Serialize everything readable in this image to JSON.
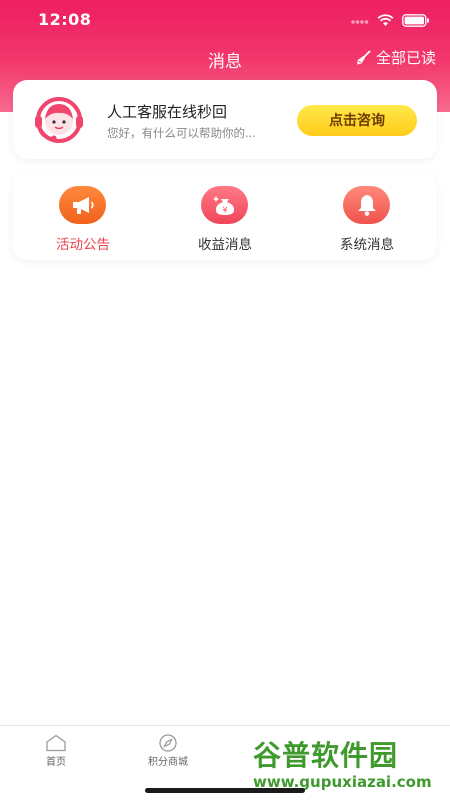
{
  "status": {
    "time": "12:08"
  },
  "header": {
    "title": "消息",
    "mark_all": "全部已读"
  },
  "service": {
    "title": "人工客服在线秒回",
    "subtitle": "您好，有什么可以帮助你的...",
    "button": "点击咨询"
  },
  "categories": [
    {
      "label": "活动公告",
      "icon": "megaphone-icon",
      "color": "#f5702a",
      "active": true
    },
    {
      "label": "收益消息",
      "icon": "money-bag-icon",
      "color": "#f35a6a",
      "active": false
    },
    {
      "label": "系统消息",
      "icon": "bell-icon",
      "color": "#f75f5a",
      "active": false
    }
  ],
  "tabbar": {
    "items": [
      {
        "label": "首页",
        "icon": "home-icon"
      },
      {
        "label": "积分商城",
        "icon": "compass-icon"
      }
    ]
  },
  "watermark": {
    "title": "谷普软件园",
    "url": "www.gupuxiazai.com"
  },
  "colors": {
    "accent": "#ee1e62",
    "button": "#ffd82a",
    "active_label": "#e8464f"
  }
}
